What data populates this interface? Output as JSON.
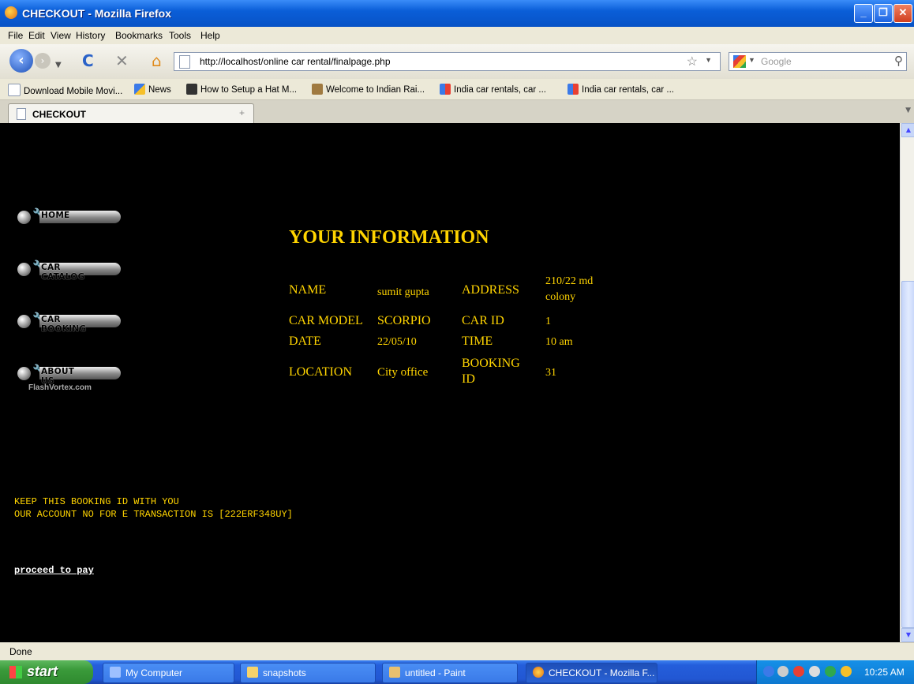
{
  "window": {
    "title": "CHECKOUT - Mozilla Firefox"
  },
  "menu": [
    "File",
    "Edit",
    "View",
    "History",
    "Bookmarks",
    "Tools",
    "Help"
  ],
  "nav": {
    "url": "http://localhost/online car rental/finalpage.php",
    "search_placeholder": "Google"
  },
  "bookmarks": [
    "Download Mobile Movi...",
    "News",
    "How to Setup a Hat M...",
    "Welcome to Indian Rai...",
    "India car rentals, car ...",
    "India car rentals, car ..."
  ],
  "tab": {
    "title": "CHECKOUT"
  },
  "sidebar_menu": [
    {
      "label": "HOME"
    },
    {
      "label": "CAR CATALOG"
    },
    {
      "label": "CAR BOOKING"
    },
    {
      "label": "ABOUT US"
    }
  ],
  "watermark": "FlashVortex.com",
  "page": {
    "heading": "YOUR INFORMATION",
    "rows": [
      {
        "l1": "NAME",
        "v1": "sumit gupta",
        "l2": "ADDRESS",
        "v2a": "210/22 md",
        "v2b": "colony"
      },
      {
        "l1": "CAR MODEL",
        "v1": "SCORPIO",
        "l2": "CAR ID",
        "v2": "1"
      },
      {
        "l1": "DATE",
        "v1": "22/05/10",
        "l2": "TIME",
        "v2": "10 am"
      },
      {
        "l1": "LOCATION",
        "v1": "City office",
        "l2a": "BOOKING",
        "l2b": "ID",
        "v2": "31"
      }
    ],
    "notice_line1": "KEEP THIS BOOKING ID WITH YOU",
    "notice_line2": "OUR ACCOUNT NO FOR E TRANSACTION IS [222ERF348UY]",
    "pay_link": "proceed to pay"
  },
  "status": "Done",
  "taskbar": {
    "start": "start",
    "items": [
      "My Computer",
      "snapshots",
      "untitled - Paint",
      "CHECKOUT - Mozilla F..."
    ],
    "clock": "10:25 AM"
  },
  "colors": {
    "accent_text": "#ffd400",
    "page_bg": "#000000",
    "titlebar": "#0a5ed8"
  }
}
